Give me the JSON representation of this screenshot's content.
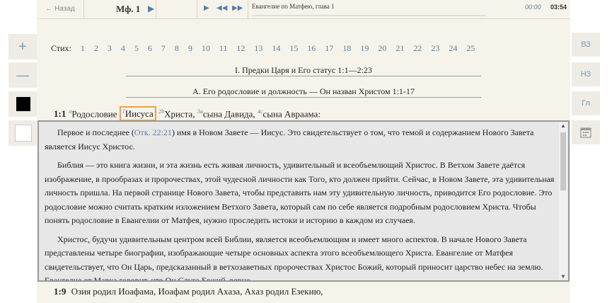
{
  "topbar": {
    "back": "← Назад",
    "reference": "Мф. 1",
    "play": "▶",
    "controls": [
      "▶",
      "◀◀",
      "▶▶"
    ],
    "track_title": "Евангелие по Матфею, глава 1",
    "elapsed": "00:00",
    "duration": "03:54"
  },
  "left_buttons": [
    "+",
    "—",
    "",
    ""
  ],
  "right_buttons": [
    "ВЗ",
    "НЗ",
    "Гл"
  ],
  "verses_label": "Стих:",
  "verses": [
    "1",
    "2",
    "3",
    "4",
    "5",
    "6",
    "7",
    "8",
    "9",
    "10",
    "11",
    "12",
    "13",
    "14",
    "15",
    "16",
    "17",
    "18",
    "19",
    "20",
    "21",
    "22",
    "23",
    "24",
    "25"
  ],
  "heading1": "I.    Предки Царя и Его статус 1:1—2:23",
  "heading2": "A.    Его родословие и должность — Он назван Христом 1:1-17",
  "verse1": {
    "num": "1:1",
    "sup_a": "a",
    "w1": "Родословие",
    "sup_1": "1",
    "w2": "Иисуса",
    "sup_2b": "2b",
    "w3": "Христа,",
    "sup_3a": "3a",
    "w4": "сына Давида,",
    "sup_4c": "4c",
    "w5": "сына Авраама:"
  },
  "popup": {
    "p1_pre": "Первое и последнее (",
    "p1_link": "Отк. 22:21",
    "p1_post": ") имя в Новом Завете — Иисус. Это свидетельствует о том, что темой и содержанием Нового Завета является Иисус Христос.",
    "p2": "Библия — это книга жизни, и эта жизнь есть живая личность, удивительный и всеобъемлющий Христос. В Ветхом Завете даётся изображение, в прообразах и пророчествах, этой чудесной личности как Того, кто должен прийти. Сейчас, в Новом Завете, эта удивительная личность пришла. На первой странице Нового Завета, чтобы представить нам эту удивительную личность, приводится Его родословие. Это родословие можно считать кратким изложением Ветхого Завета, который сам по себе является подробным родословием Христа. Чтобы понять родословие в Евангелии от Матфея, нужно проследить истоки и историю в каждом из случаев.",
    "p3": "Христос, будучи удивительным центром всей Библии, является всеобъемлющим и имеет много аспектов. В начале Нового Завета представлены четыре биографии, изображающие четыре основных аспекта этого всеобъемлющего Христа. Евангелие от Матфея свидетельствует, что Он Царь, предсказанный в ветхозаветных пророчествах Христос Божий, который приносит царство небес на землю. Евангелие от Марка говорит, что Он Слуга Божий, верно"
  },
  "verse9": {
    "num": "1:9",
    "text": "Озия родил Иоафама, Иоафам родил Ахаза, Ахаз родил Езекию,"
  }
}
